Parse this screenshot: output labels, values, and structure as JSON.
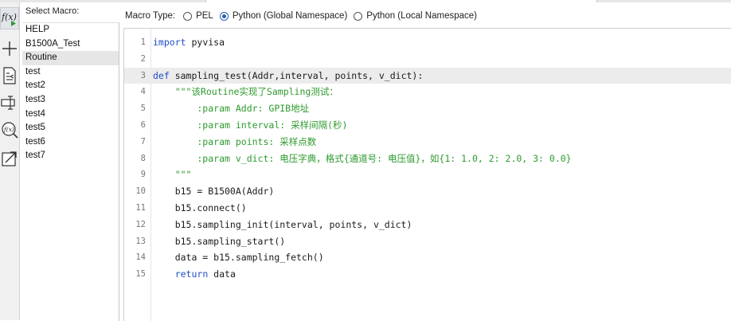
{
  "select_macro_label": "Select Macro:",
  "macros": [
    "HELP",
    "B1500A_Test",
    "Routine",
    "test",
    "test2",
    "test3",
    "test4",
    "test5",
    "test6",
    "test7"
  ],
  "selected_macro": "Routine",
  "macro_type": {
    "label": "Macro Type:",
    "options": [
      "PEL",
      "Python (Global Namespace)",
      "Python (Local Namespace)"
    ],
    "selected": "Python (Global Namespace)"
  },
  "toolbar_icons": [
    "function-run-icon",
    "add-icon",
    "import-icon",
    "rename-icon",
    "function-search-icon",
    "export-icon"
  ],
  "colors": {
    "keyword": "#1f4fc4",
    "docstring": "#2e9a2e",
    "current_line": "#ececec",
    "radio_accent": "#2a5fb0"
  },
  "editor": {
    "current_line": 3,
    "lines": [
      {
        "n": "1",
        "tokens": [
          {
            "t": "import",
            "k": "kw"
          },
          {
            "t": " pyvisa",
            "k": ""
          }
        ]
      },
      {
        "n": "2",
        "tokens": []
      },
      {
        "n": "3",
        "tokens": [
          {
            "t": "def",
            "k": "kw"
          },
          {
            "t": " sampling_test(Addr,interval, points, v_dict):",
            "k": ""
          }
        ]
      },
      {
        "n": "4",
        "tokens": [
          {
            "t": "    \"\"\"该Routine实现了Sampling测试：",
            "k": "str"
          }
        ]
      },
      {
        "n": "5",
        "tokens": [
          {
            "t": "        :param Addr: GPIB地址",
            "k": "str"
          }
        ]
      },
      {
        "n": "6",
        "tokens": [
          {
            "t": "        :param interval: 采样间隔(秒)",
            "k": "str"
          }
        ]
      },
      {
        "n": "7",
        "tokens": [
          {
            "t": "        :param points: 采样点数",
            "k": "str"
          }
        ]
      },
      {
        "n": "8",
        "tokens": [
          {
            "t": "        :param v_dict: 电压字典，格式{通道号: 电压值}，如{1: 1.0, 2: 2.0, 3: 0.0}",
            "k": "str"
          }
        ]
      },
      {
        "n": "9",
        "tokens": [
          {
            "t": "    \"\"\"",
            "k": "str"
          }
        ]
      },
      {
        "n": "10",
        "tokens": [
          {
            "t": "    b15 = B1500A(Addr)",
            "k": ""
          }
        ]
      },
      {
        "n": "11",
        "tokens": [
          {
            "t": "    b15.connect()",
            "k": ""
          }
        ]
      },
      {
        "n": "12",
        "tokens": [
          {
            "t": "    b15.sampling_init(interval, points, v_dict)",
            "k": ""
          }
        ]
      },
      {
        "n": "13",
        "tokens": [
          {
            "t": "    b15.sampling_start()",
            "k": ""
          }
        ]
      },
      {
        "n": "14",
        "tokens": [
          {
            "t": "    data = b15.sampling_fetch()",
            "k": ""
          }
        ]
      },
      {
        "n": "15",
        "tokens": [
          {
            "t": "    ",
            "k": ""
          },
          {
            "t": "return",
            "k": "kw"
          },
          {
            "t": " data",
            "k": ""
          }
        ]
      }
    ]
  }
}
